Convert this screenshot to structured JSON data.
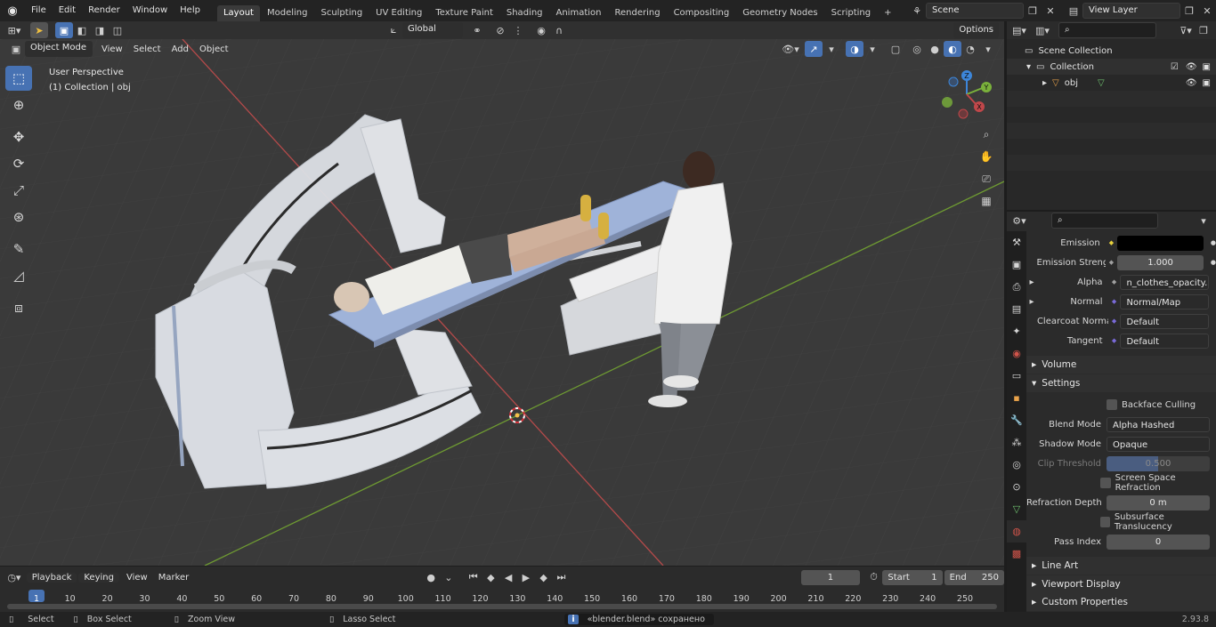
{
  "topbar": {
    "menus": [
      "File",
      "Edit",
      "Render",
      "Window",
      "Help"
    ],
    "workspaces": [
      "Layout",
      "Modeling",
      "Sculpting",
      "UV Editing",
      "Texture Paint",
      "Shading",
      "Animation",
      "Rendering",
      "Compositing",
      "Geometry Nodes",
      "Scripting"
    ],
    "active_workspace": "Layout",
    "add_tab": "+",
    "scene": "Scene",
    "view_layer": "View Layer"
  },
  "viewport": {
    "mode": "Object Mode",
    "menus": [
      "View",
      "Select",
      "Add",
      "Object"
    ],
    "transform": "Global",
    "options": "Options",
    "overlay_title": "User Perspective",
    "overlay_sub": "(1) Collection | obj",
    "gizmo": {
      "z": "Z",
      "y": "Y",
      "x": "X"
    }
  },
  "outliner": {
    "root": "Scene Collection",
    "collection": "Collection",
    "object": "obj"
  },
  "properties": {
    "rows": [
      {
        "label": "Emission",
        "value": ""
      },
      {
        "label": "Emission Strengt",
        "value": "1.000"
      },
      {
        "label": "Alpha",
        "value": "n_clothes_opacity.png"
      },
      {
        "label": "Normal",
        "value": "Normal/Map"
      },
      {
        "label": "Clearcoat Normal",
        "value": "Default"
      },
      {
        "label": "Tangent",
        "value": "Default"
      }
    ],
    "volume": "Volume",
    "settings": "Settings",
    "backface": "Backface Culling",
    "blend_label": "Blend Mode",
    "blend_value": "Alpha Hashed",
    "shadow_label": "Shadow Mode",
    "shadow_value": "Opaque",
    "clip_label": "Clip Threshold",
    "clip_value": "0.500",
    "ssr": "Screen Space Refraction",
    "refr_label": "Refraction Depth",
    "refr_value": "0 m",
    "sss": "Subsurface Translucency",
    "pass_label": "Pass Index",
    "pass_value": "0",
    "line_art": "Line Art",
    "viewport_display": "Viewport Display",
    "custom_props": "Custom Properties"
  },
  "timeline": {
    "menus": [
      "Playback",
      "Keying",
      "View",
      "Marker"
    ],
    "current_frame": "1",
    "start_label": "Start",
    "start": "1",
    "end_label": "End",
    "end": "250",
    "ticks": [
      "1",
      "10",
      "20",
      "30",
      "40",
      "50",
      "60",
      "70",
      "80",
      "90",
      "100",
      "110",
      "120",
      "130",
      "140",
      "150",
      "160",
      "170",
      "180",
      "190",
      "200",
      "210",
      "220",
      "230",
      "240",
      "250"
    ]
  },
  "status": {
    "select": "Select",
    "box_select": "Box Select",
    "zoom_view": "Zoom View",
    "lasso": "Lasso Select",
    "message": "«blender.blend» сохранено",
    "version": "2.93.8"
  },
  "colors": {
    "accent": "#4772b3",
    "x_axis": "#c0474a",
    "y_axis": "#7ab13b",
    "z_axis": "#3d86d9"
  }
}
